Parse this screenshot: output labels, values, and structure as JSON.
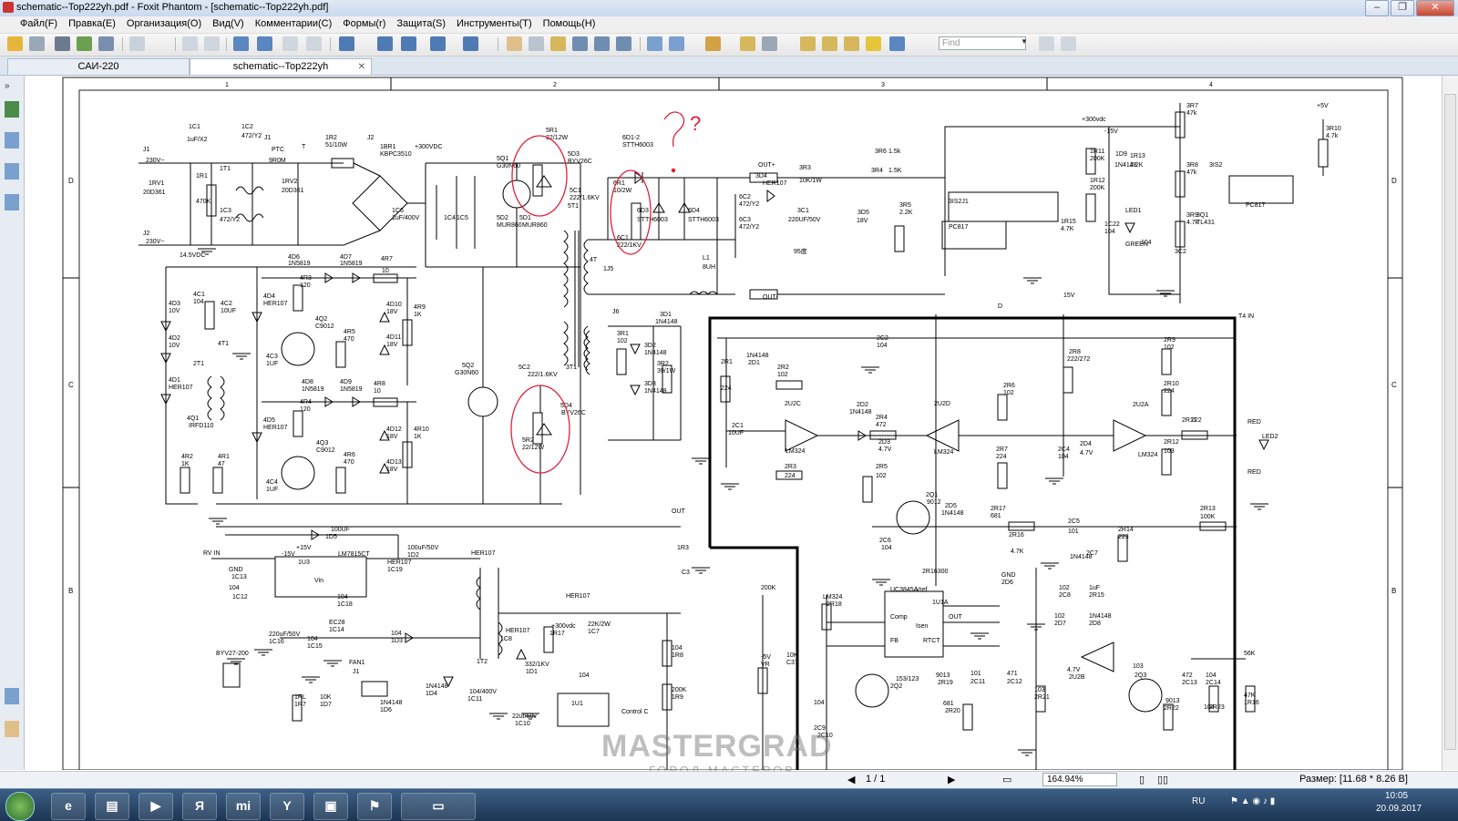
{
  "window": {
    "title": "schematic--Top222yh.pdf - Foxit Phantom - [schematic--Top222yh.pdf]",
    "buttons": [
      "–",
      "❐",
      "✕"
    ]
  },
  "menu": [
    "Файл(F)",
    "Правка(E)",
    "Организация(O)",
    "Вид(V)",
    "Комментарии(C)",
    "Формы(r)",
    "Защита(S)",
    "Инструменты(T)",
    "Помощь(H)"
  ],
  "toolbar": {
    "find_placeholder": "Find"
  },
  "tabs": [
    {
      "label": "САИ-220"
    },
    {
      "label": "schematic--Top222yh"
    }
  ],
  "schematic": {
    "grid_cols": [
      "1",
      "2",
      "3",
      "4"
    ],
    "grid_rows": [
      "D",
      "C",
      "B"
    ],
    "annotation_question": "?",
    "labels": [
      "J1",
      "230V~",
      "J2",
      "230V~",
      "1C1",
      "1uF/X2",
      "1RV1",
      "20D361",
      "1R1",
      "470K",
      "1C2",
      "472/Y2",
      "1T1",
      "1C3",
      "472/Y2",
      "J1",
      "PTC",
      "9R0M",
      "T",
      "1RV2",
      "20D361",
      "1R2",
      "51/10W",
      "J2",
      "1BR1",
      "KBPC3510",
      "1C6",
      "1uF/400V",
      "+300VDC",
      "1C4",
      "1C5",
      "5Q1",
      "G30N60",
      "5R1",
      "22/12W",
      "5D3",
      "BYV26C",
      "5D2",
      "MUR860",
      "5D1",
      "MUR860",
      "5C1",
      "222/1.6KV",
      "5T1",
      "6D1-2",
      "STTH6003",
      "6R1",
      "10/2W",
      "6D3",
      "STTH6003",
      "6D4",
      "STTH6003",
      "6C1",
      "222/1KV",
      "4T",
      "1J5",
      "6C2",
      "472/Y2",
      "6C3",
      "472/Y2",
      "OUT+",
      "3D4",
      "HER107",
      "3R3",
      "10K/1W",
      "3C1",
      "220UF/50V",
      "3R6",
      "1.5k",
      "3R4",
      "1.5K",
      "3D5",
      "18V",
      "3R5",
      "2.2K",
      "L1",
      "8UH",
      "OUT-",
      "95度",
      "3IS2J1",
      "PC817",
      "+300vdc",
      "-15V",
      "1R11",
      "200K",
      "1D9",
      "1N4148",
      "1R13",
      "2.2K",
      "1R12",
      "200K",
      "1R15",
      "4.7K",
      "1C22",
      "104",
      "LED1",
      "GREEN",
      "104",
      "3R7",
      "47k",
      "3R8",
      "47k",
      "3R9",
      "4.7k",
      "3C2",
      "3Q1",
      "TL431",
      "3IS2",
      "PC817",
      "+5V",
      "3R10",
      "4.7k",
      "14.5VDC",
      "4D6",
      "1N5819",
      "4D7",
      "1N5819",
      "4R7",
      "10",
      "4D4",
      "HER107",
      "4R3",
      "120",
      "4Q2",
      "C9012",
      "4R5",
      "470",
      "4D10",
      "18V",
      "4R9",
      "1K",
      "4D11",
      "18V",
      "4D3",
      "10V",
      "4C1",
      "104",
      "4C2",
      "10UF",
      "4D2",
      "10V",
      "4T1",
      "4C3",
      "1UF",
      "4D1",
      "HER107",
      "2T1",
      "4D8",
      "1N5819",
      "4D9",
      "1N5819",
      "4R8",
      "10",
      "4D5",
      "HER107",
      "4R4",
      "120",
      "4Q3",
      "C9012",
      "4R6",
      "470",
      "4D12",
      "18V",
      "4R10",
      "1K",
      "4D13",
      "18V",
      "4Q1",
      "IRFD110",
      "4R2",
      "1K",
      "4R1",
      "47",
      "4C4",
      "1UF",
      "5Q2",
      "G30N60",
      "5C2",
      "222/1.6KV",
      "5D4",
      "BYV26C",
      "5R2",
      "22/12W",
      "3T1",
      "J6",
      "3R1",
      "102",
      "3D1",
      "1N4148",
      "3D2",
      "1N4148",
      "3R2",
      "39/1W",
      "3D3",
      "1N4148",
      "OUT",
      "T4 IN",
      "D",
      "15V",
      "2C2",
      "104",
      "2R1",
      "224",
      "1N4148",
      "2D1",
      "2R2",
      "102",
      "2U2C",
      "LM324",
      "2C1",
      "10UF",
      "2R3",
      "224",
      "2D2",
      "1N4148",
      "2R4",
      "472",
      "2D3",
      "4.7V",
      "2R5",
      "102",
      "2U2D",
      "LM324",
      "2R6",
      "102",
      "2R7",
      "224",
      "2R8",
      "222/272",
      "2C4",
      "104",
      "2D4",
      "4.7V",
      "2U2A",
      "LM324",
      "2R9",
      "102",
      "2R10",
      "224",
      "2R11",
      "222",
      "2R12",
      "103",
      "RED",
      "LED2",
      "RED",
      "2Q1",
      "9012",
      "2D5",
      "1N4148",
      "2R17",
      "681",
      "2C5",
      "101",
      "2R13",
      "100K",
      "2R14",
      "223",
      "2C6",
      "104",
      "2R16",
      "4.7K",
      "2R16300",
      "1U1A",
      "UC3845A",
      "Vref",
      "Comp",
      "OUT",
      "FB",
      "RTCT",
      "Isen",
      "GND",
      "2D6",
      "1N4148",
      "2C7",
      "102",
      "2C8",
      "1uF",
      "2R15",
      "102",
      "2D7",
      "1N4148",
      "2D8",
      "4.7V",
      "2U2B",
      "LM324",
      "2R18",
      "153/123",
      "2Q2",
      "9013",
      "2R19",
      "681",
      "2R20",
      "101",
      "2C11",
      "471",
      "2C12",
      "103",
      "2R21",
      "103",
      "2Q3",
      "9013",
      "2R22",
      "472",
      "2C13",
      "104",
      "2C14",
      "104",
      "2R23",
      "47K",
      "1R16",
      "56K",
      "RV IN",
      "-15V",
      "+15V",
      "1U3",
      "LM7815CT",
      "Vin",
      "GND",
      "1C13",
      "104",
      "1C12",
      "100UF",
      "1D5",
      "HER107",
      "1C19",
      "104",
      "1C18",
      "100uF/50V",
      "1D2",
      "HER107",
      "1T2",
      "EC28",
      "1C14",
      "220uF/50V",
      "1C16",
      "104",
      "1C15",
      "104",
      "1D3",
      "BYV27-200",
      "FAN1",
      "J1",
      "1RL",
      "1R7",
      "10K",
      "1D7",
      "1N4148",
      "1D6",
      "1N4148",
      "1D4",
      "HER107",
      "1C8",
      "332/1KV",
      "1D1",
      "HER107",
      "+300vdc",
      "1R17",
      "22K/2W",
      "1C7",
      "104/400V",
      "1C11",
      "22uf/50v",
      "1C10",
      "104",
      "1U1",
      "Control C",
      "1R3",
      "C3",
      "104",
      "1R8",
      "200K",
      "1R9",
      "200K",
      "-5V",
      "VR",
      "10K",
      "C37",
      "104",
      "2C9",
      "2C10",
      "102"
    ],
    "watermark": "MASTERGRAD",
    "watermark_sub": "ГОРОД МАСТЕРОВ"
  },
  "statusbar": {
    "page": "1 / 1",
    "zoom": "164.94%",
    "size": "Размер: [11.68 * 8.26 B]"
  },
  "taskbar": {
    "lang": "RU",
    "time": "10:05",
    "date": "20.09.2017"
  }
}
